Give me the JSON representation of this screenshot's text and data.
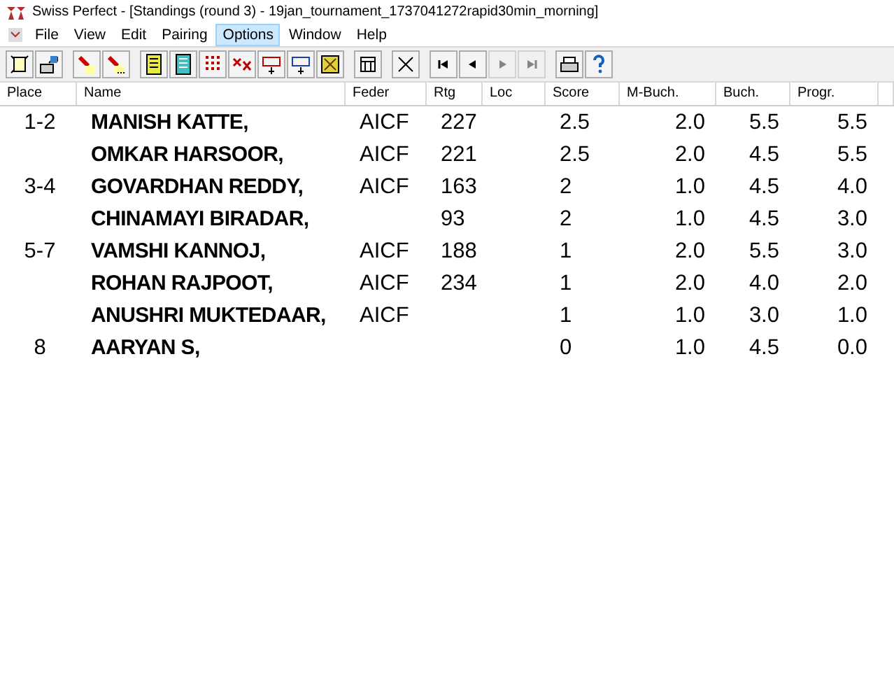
{
  "window": {
    "title": "Swiss Perfect - [Standings  (round 3) - 19jan_tournament_1737041272rapid30min_morning]"
  },
  "menu": [
    {
      "label": "File",
      "selected": false
    },
    {
      "label": "View",
      "selected": false
    },
    {
      "label": "Edit",
      "selected": false
    },
    {
      "label": "Pairing",
      "selected": false
    },
    {
      "label": "Options",
      "selected": true
    },
    {
      "label": "Window",
      "selected": false
    },
    {
      "label": "Help",
      "selected": false
    }
  ],
  "toolbar": [
    {
      "disabled": false
    },
    {
      "disabled": false
    },
    {
      "disabled": false
    },
    {
      "disabled": false
    },
    {
      "disabled": false
    },
    {
      "disabled": false
    },
    {
      "disabled": false
    },
    {
      "disabled": false
    },
    {
      "disabled": false
    },
    {
      "disabled": false
    },
    {
      "disabled": false
    },
    {
      "disabled": false
    },
    {
      "disabled": false
    },
    {
      "disabled": false
    },
    {
      "disabled": false
    },
    {
      "disabled": true
    },
    {
      "disabled": true
    },
    {
      "disabled": false
    },
    {
      "disabled": false
    }
  ],
  "table": {
    "columns": [
      "Place",
      "Name",
      "Feder",
      "Rtg",
      "Loc",
      "Score",
      "M-Buch.",
      "Buch.",
      "Progr."
    ],
    "rows": [
      {
        "place": "1-2",
        "name": "MANISH KATTE,",
        "feder": "AICF",
        "rtg": "227",
        "score": "2.5",
        "mbuch": "2.0",
        "buch": "5.5",
        "progr": "5.5"
      },
      {
        "place": "",
        "name": "OMKAR HARSOOR,",
        "feder": "AICF",
        "rtg": "221",
        "score": "2.5",
        "mbuch": "2.0",
        "buch": "4.5",
        "progr": "5.5"
      },
      {
        "place": "3-4",
        "name": "GOVARDHAN REDDY,",
        "feder": "AICF",
        "rtg": "163",
        "score": "2",
        "mbuch": "1.0",
        "buch": "4.5",
        "progr": "4.0"
      },
      {
        "place": "",
        "name": "CHINAMAYI BIRADAR,",
        "feder": "",
        "rtg": "93",
        "score": "2",
        "mbuch": "1.0",
        "buch": "4.5",
        "progr": "3.0"
      },
      {
        "place": "5-7",
        "name": "VAMSHI KANNOJ,",
        "feder": "AICF",
        "rtg": "188",
        "score": "1",
        "mbuch": "2.0",
        "buch": "5.5",
        "progr": "3.0"
      },
      {
        "place": "",
        "name": "ROHAN RAJPOOT,",
        "feder": "AICF",
        "rtg": "234",
        "score": "1",
        "mbuch": "2.0",
        "buch": "4.0",
        "progr": "2.0"
      },
      {
        "place": "",
        "name": "ANUSHRI MUKTEDAAR,",
        "feder": "AICF",
        "rtg": "",
        "score": "1",
        "mbuch": "1.0",
        "buch": "3.0",
        "progr": "1.0"
      },
      {
        "place": "8",
        "name": "AARYAN S,",
        "feder": "",
        "rtg": "",
        "score": "0",
        "mbuch": "1.0",
        "buch": "4.5",
        "progr": "0.0"
      }
    ]
  }
}
